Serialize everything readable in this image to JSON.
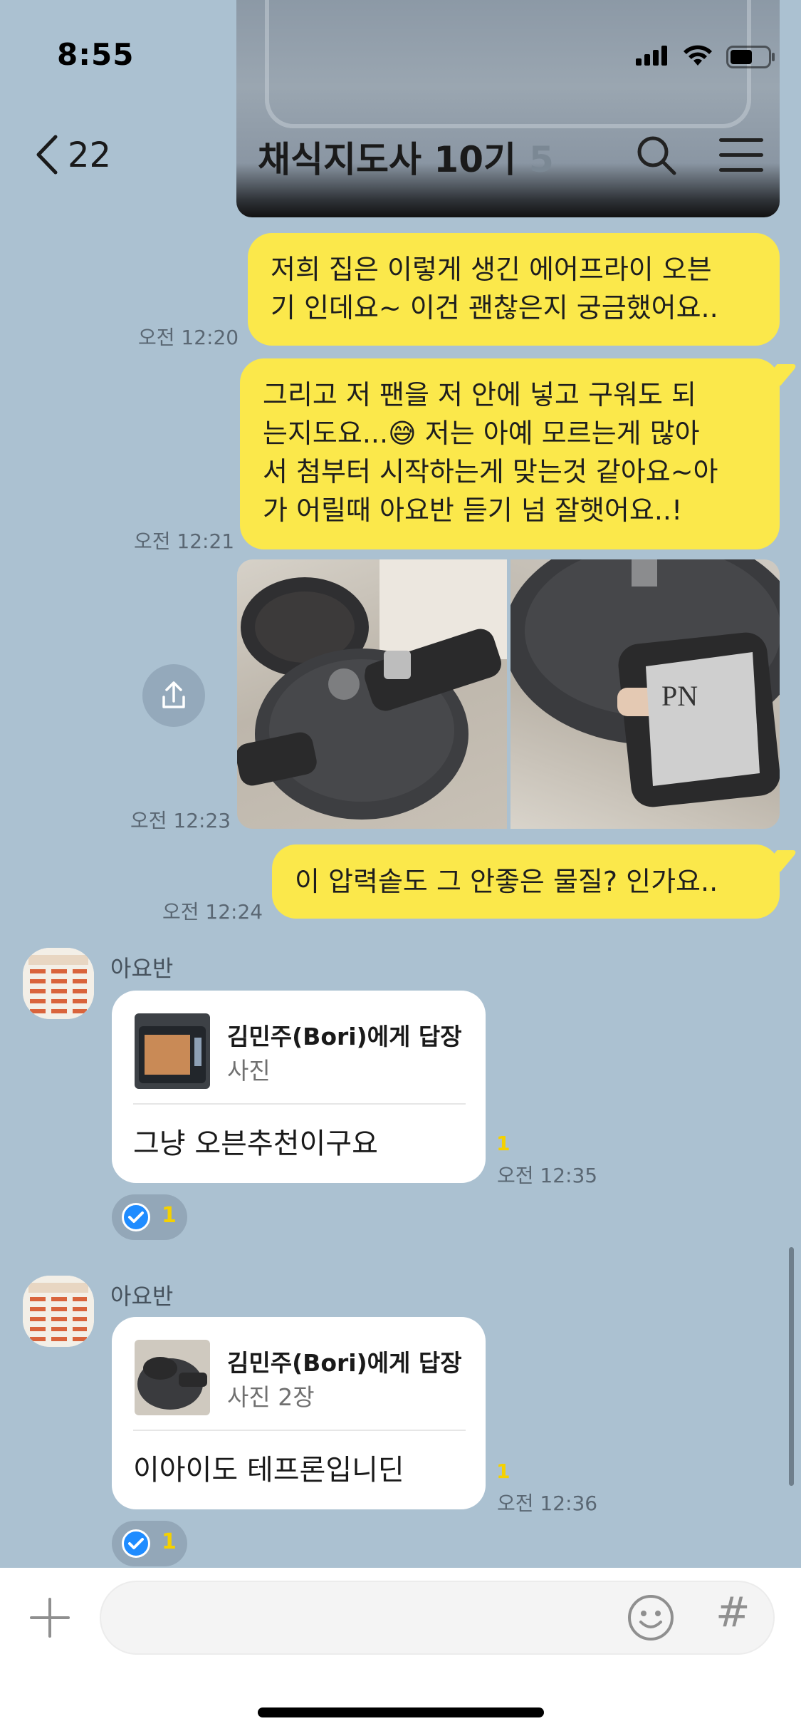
{
  "status_bar": {
    "time": "8:55",
    "icons": [
      "signal-icon",
      "wifi-icon",
      "battery-icon"
    ]
  },
  "header": {
    "back_count": "22",
    "title": "채식지도사 10기",
    "member_count": "5",
    "icons": [
      "chevron-left-icon",
      "search-icon",
      "menu-icon"
    ]
  },
  "messages": [
    {
      "from": "me",
      "text_lines": [
        "저희 집은 이렇게 생긴 에어프라이 오븐",
        "기 인데요~ 이건 괜찮은지 궁금했어요.."
      ],
      "time": "오전 12:20"
    },
    {
      "from": "me",
      "text_lines": [
        "그리고 저 팬을 저 안에 넣고 구워도 되",
        "는지도요...😅 저는 아예 모르는게 많아",
        "서 첨부터 시작하는게 맞는것 같아요~아",
        "가 어릴때 아요반 듣기 넘 잘햇어요..!"
      ],
      "time": "오전 12:21"
    },
    {
      "from": "me",
      "type": "photos",
      "count": 2,
      "time": "오전 12:23"
    },
    {
      "from": "me",
      "text": "이 압력솥도 그 안좋은 물질? 인가요..",
      "time": "오전 12:24"
    },
    {
      "from": "아요반",
      "reply_to": "김민주(Bori)에게 답장",
      "reply_sub": "사진",
      "text": "그냥 오븐추천이구요",
      "unread": "1",
      "time": "오전 12:35",
      "reaction_count": "1"
    },
    {
      "from": "아요반",
      "reply_to": "김민주(Bori)에게 답장",
      "reply_sub": "사진 2장",
      "text": "이아이도 테프론입니딘",
      "unread": "1",
      "time": "오전 12:36",
      "reaction_count": "1"
    }
  ],
  "input_bar": {
    "hash_label": "#",
    "icons": [
      "plus-icon",
      "emoji-icon"
    ]
  },
  "colors": {
    "background": "#abc1d1",
    "my_bubble": "#fbe84b",
    "other_bubble": "#ffffff",
    "unread": "#f5d100",
    "check": "#1f8cff"
  }
}
